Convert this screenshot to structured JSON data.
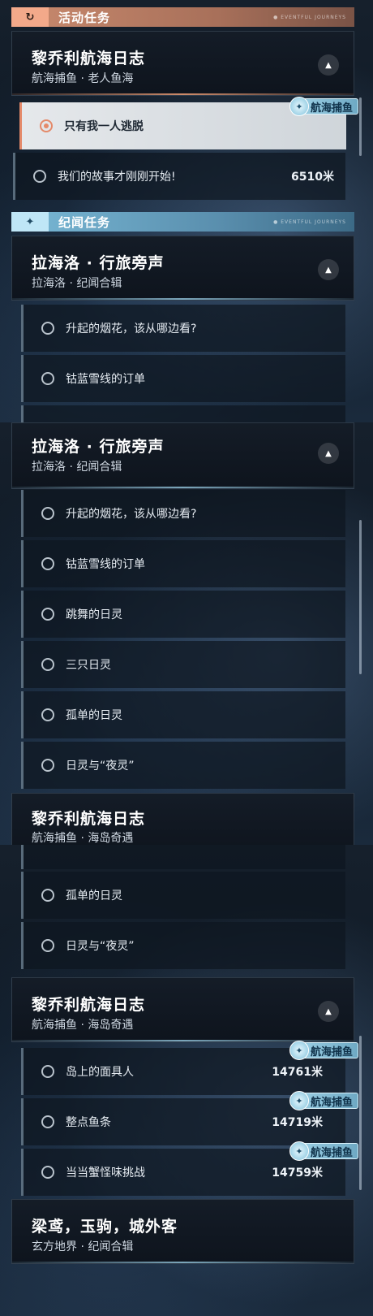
{
  "categories": {
    "activity": {
      "title": "活动任务",
      "tag": "● EVENTFUL  JOURNEYS",
      "icon": "refresh-arrow-icon",
      "color": "#c98a6e"
    },
    "chronicle": {
      "title": "纪闻任务",
      "tag": "● EVENTFUL  JOURNEYS",
      "icon": "sparkle-icon",
      "color": "#79b9d6"
    }
  },
  "quests": {
    "lichery_old": {
      "title": "黎乔利航海日志",
      "subtitle": "航海捕鱼 · 老人鱼海"
    },
    "lahailuo": {
      "title": "拉海洛 · 行旅旁声",
      "subtitle": "拉海洛 · 纪闻合辑"
    },
    "lichery_island": {
      "title": "黎乔利航海日志",
      "subtitle": "航海捕鱼 · 海岛奇遇"
    },
    "lichery_island_clip": {
      "title": "黎乔利航海日志",
      "subtitle": "航海捕鱼 · 海岛奇遇"
    },
    "liangyuan": {
      "title": "梁鸢，玉驹，城外客",
      "subtitle": "玄方地界 · 纪闻合辑"
    }
  },
  "items": {
    "escape": "只有我一人逃脱",
    "story": "我们的故事才刚刚开始!",
    "story_dist": "6510米",
    "fireworks": "升起的烟花，该从哪边看?",
    "cobalt": "钴蓝雪线的订单",
    "dancing": "跳舞的日灵",
    "three": "三只日灵",
    "lonely": "孤单的日灵",
    "night": "日灵与“夜灵”",
    "mask": "岛上的面具人",
    "mask_dist": "14761米",
    "fish": "整点鱼条",
    "fish_dist": "14719米",
    "crab": "当当蟹怪味挑战",
    "crab_dist": "14759米"
  },
  "badge": {
    "label": "航海捕鱼",
    "icon": "fish-icon"
  },
  "icons": {
    "collapse": "chevron-up-icon",
    "radio": "radio-icon"
  }
}
